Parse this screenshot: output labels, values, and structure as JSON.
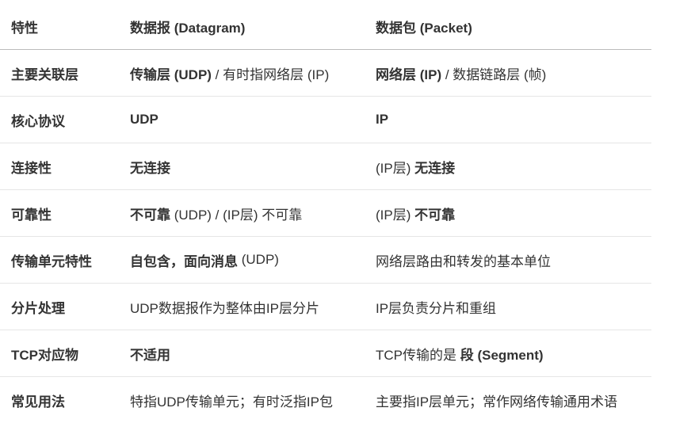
{
  "header": [
    "特性",
    "数据报 (Datagram)",
    "数据包 (Packet)"
  ],
  "rows": [
    {
      "feature": "主要关联层",
      "datagram": [
        {
          "text": "传输层 (UDP)",
          "bold": true
        },
        {
          "text": " / 有时指网络层 (IP)",
          "bold": false
        }
      ],
      "packet": [
        {
          "text": "网络层 (IP)",
          "bold": true
        },
        {
          "text": " / 数据链路层 (帧)",
          "bold": false
        }
      ]
    },
    {
      "feature": "核心协议",
      "datagram": [
        {
          "text": "UDP",
          "bold": true
        }
      ],
      "packet": [
        {
          "text": "IP",
          "bold": true
        }
      ]
    },
    {
      "feature": "连接性",
      "datagram": [
        {
          "text": "无连接",
          "bold": true
        }
      ],
      "packet": [
        {
          "text": "(IP层) ",
          "bold": false
        },
        {
          "text": "无连接",
          "bold": true
        }
      ]
    },
    {
      "feature": "可靠性",
      "datagram": [
        {
          "text": "不可靠",
          "bold": true
        },
        {
          "text": " (UDP) / (IP层) 不可靠",
          "bold": false
        }
      ],
      "packet": [
        {
          "text": "(IP层) ",
          "bold": false
        },
        {
          "text": "不可靠",
          "bold": true
        }
      ]
    },
    {
      "feature": "传输单元特性",
      "datagram": [
        {
          "text": "自包含，面向消息",
          "bold": true
        },
        {
          "text": " (UDP)",
          "bold": false
        }
      ],
      "packet": [
        {
          "text": "网络层路由和转发的基本单位",
          "bold": false
        }
      ]
    },
    {
      "feature": "分片处理",
      "datagram": [
        {
          "text": "UDP数据报作为整体由IP层分片",
          "bold": false
        }
      ],
      "packet": [
        {
          "text": "IP层负责分片和重组",
          "bold": false
        }
      ]
    },
    {
      "feature": "TCP对应物",
      "datagram": [
        {
          "text": "不适用",
          "bold": true
        }
      ],
      "packet": [
        {
          "text": "TCP传输的是 ",
          "bold": false
        },
        {
          "text": "段 (Segment)",
          "bold": true
        }
      ]
    },
    {
      "feature": "常见用法",
      "datagram": [
        {
          "text": "特指UDP传输单元；有时泛指IP包",
          "bold": false
        }
      ],
      "packet": [
        {
          "text": "主要指IP层单元；常作网络传输通用术语",
          "bold": false
        }
      ]
    }
  ]
}
